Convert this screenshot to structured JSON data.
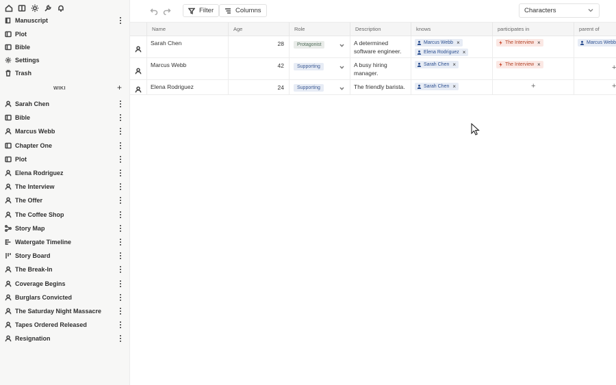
{
  "sidebar": {
    "top_icons": [
      "home-icon",
      "book-open-icon",
      "sun-icon",
      "wrench-icon",
      "bell-icon"
    ],
    "sections": [
      {
        "label": "Manuscript",
        "icon": "book-icon",
        "menu": true
      },
      {
        "label": "Plot",
        "icon": "folder-icon",
        "menu": false
      },
      {
        "label": "Bible",
        "icon": "folder-icon",
        "menu": false
      },
      {
        "label": "Settings",
        "icon": "gear-icon",
        "menu": false
      },
      {
        "label": "Trash",
        "icon": "trash-icon",
        "menu": false
      }
    ],
    "wiki_heading": "WIKI",
    "wiki_items": [
      {
        "label": "Sarah Chen",
        "icon": "person-icon"
      },
      {
        "label": "Bible",
        "icon": "folder-icon"
      },
      {
        "label": "Marcus Webb",
        "icon": "person-icon"
      },
      {
        "label": "Chapter One",
        "icon": "folder-icon"
      },
      {
        "label": "Plot",
        "icon": "folder-icon"
      },
      {
        "label": "Elena Rodriguez",
        "icon": "person-icon"
      },
      {
        "label": "The Interview",
        "icon": "person-icon"
      },
      {
        "label": "The Offer",
        "icon": "person-icon"
      },
      {
        "label": "The Coffee Shop",
        "icon": "person-icon"
      },
      {
        "label": "Story Map",
        "icon": "network-icon"
      },
      {
        "label": "Watergate Timeline",
        "icon": "timeline-icon"
      },
      {
        "label": "Story Board",
        "icon": "board-icon"
      },
      {
        "label": "The Break-In",
        "icon": "person-icon"
      },
      {
        "label": "Coverage Begins",
        "icon": "person-icon"
      },
      {
        "label": "Burglars Convicted",
        "icon": "person-icon"
      },
      {
        "label": "The Saturday Night Massacre",
        "icon": "person-icon"
      },
      {
        "label": "Tapes Ordered Released",
        "icon": "person-icon"
      },
      {
        "label": "Resignation",
        "icon": "person-icon"
      }
    ]
  },
  "toolbar": {
    "filter_label": "Filter",
    "columns_label": "Columns",
    "view_select": "Characters"
  },
  "table": {
    "columns": [
      "Name",
      "Age",
      "Role",
      "Description",
      "knows",
      "participates in",
      "parent of"
    ],
    "rows": [
      {
        "name": "Sarah Chen",
        "age": "28",
        "role": "Protagonist",
        "role_type": "protagonist",
        "description": "A determined software engineer.",
        "knows": [
          "Marcus Webb",
          "Elena Rodriguez"
        ],
        "participates_in": [
          "The Interview"
        ],
        "parent_of": [
          "Marcus Webb"
        ]
      },
      {
        "name": "Marcus Webb",
        "age": "42",
        "role": "Supporting",
        "role_type": "supporting",
        "description": "A busy hiring manager.",
        "knows": [
          "Sarah Chen"
        ],
        "participates_in": [
          "The Interview"
        ],
        "parent_of": []
      },
      {
        "name": "Elena Rodriguez",
        "age": "24",
        "role": "Supporting",
        "role_type": "supporting",
        "description": "The friendly barista.",
        "knows": [
          "Sarah Chen"
        ],
        "participates_in": [],
        "parent_of": []
      }
    ]
  },
  "colors": {
    "person_chip_bg": "#e7ecf5",
    "person_chip_text": "#2c4f90",
    "event_chip_bg": "#fbe8e4",
    "event_chip_text": "#b34226",
    "protagonist_bg": "#e9ece9",
    "supporting_bg": "#e7ecf5"
  }
}
